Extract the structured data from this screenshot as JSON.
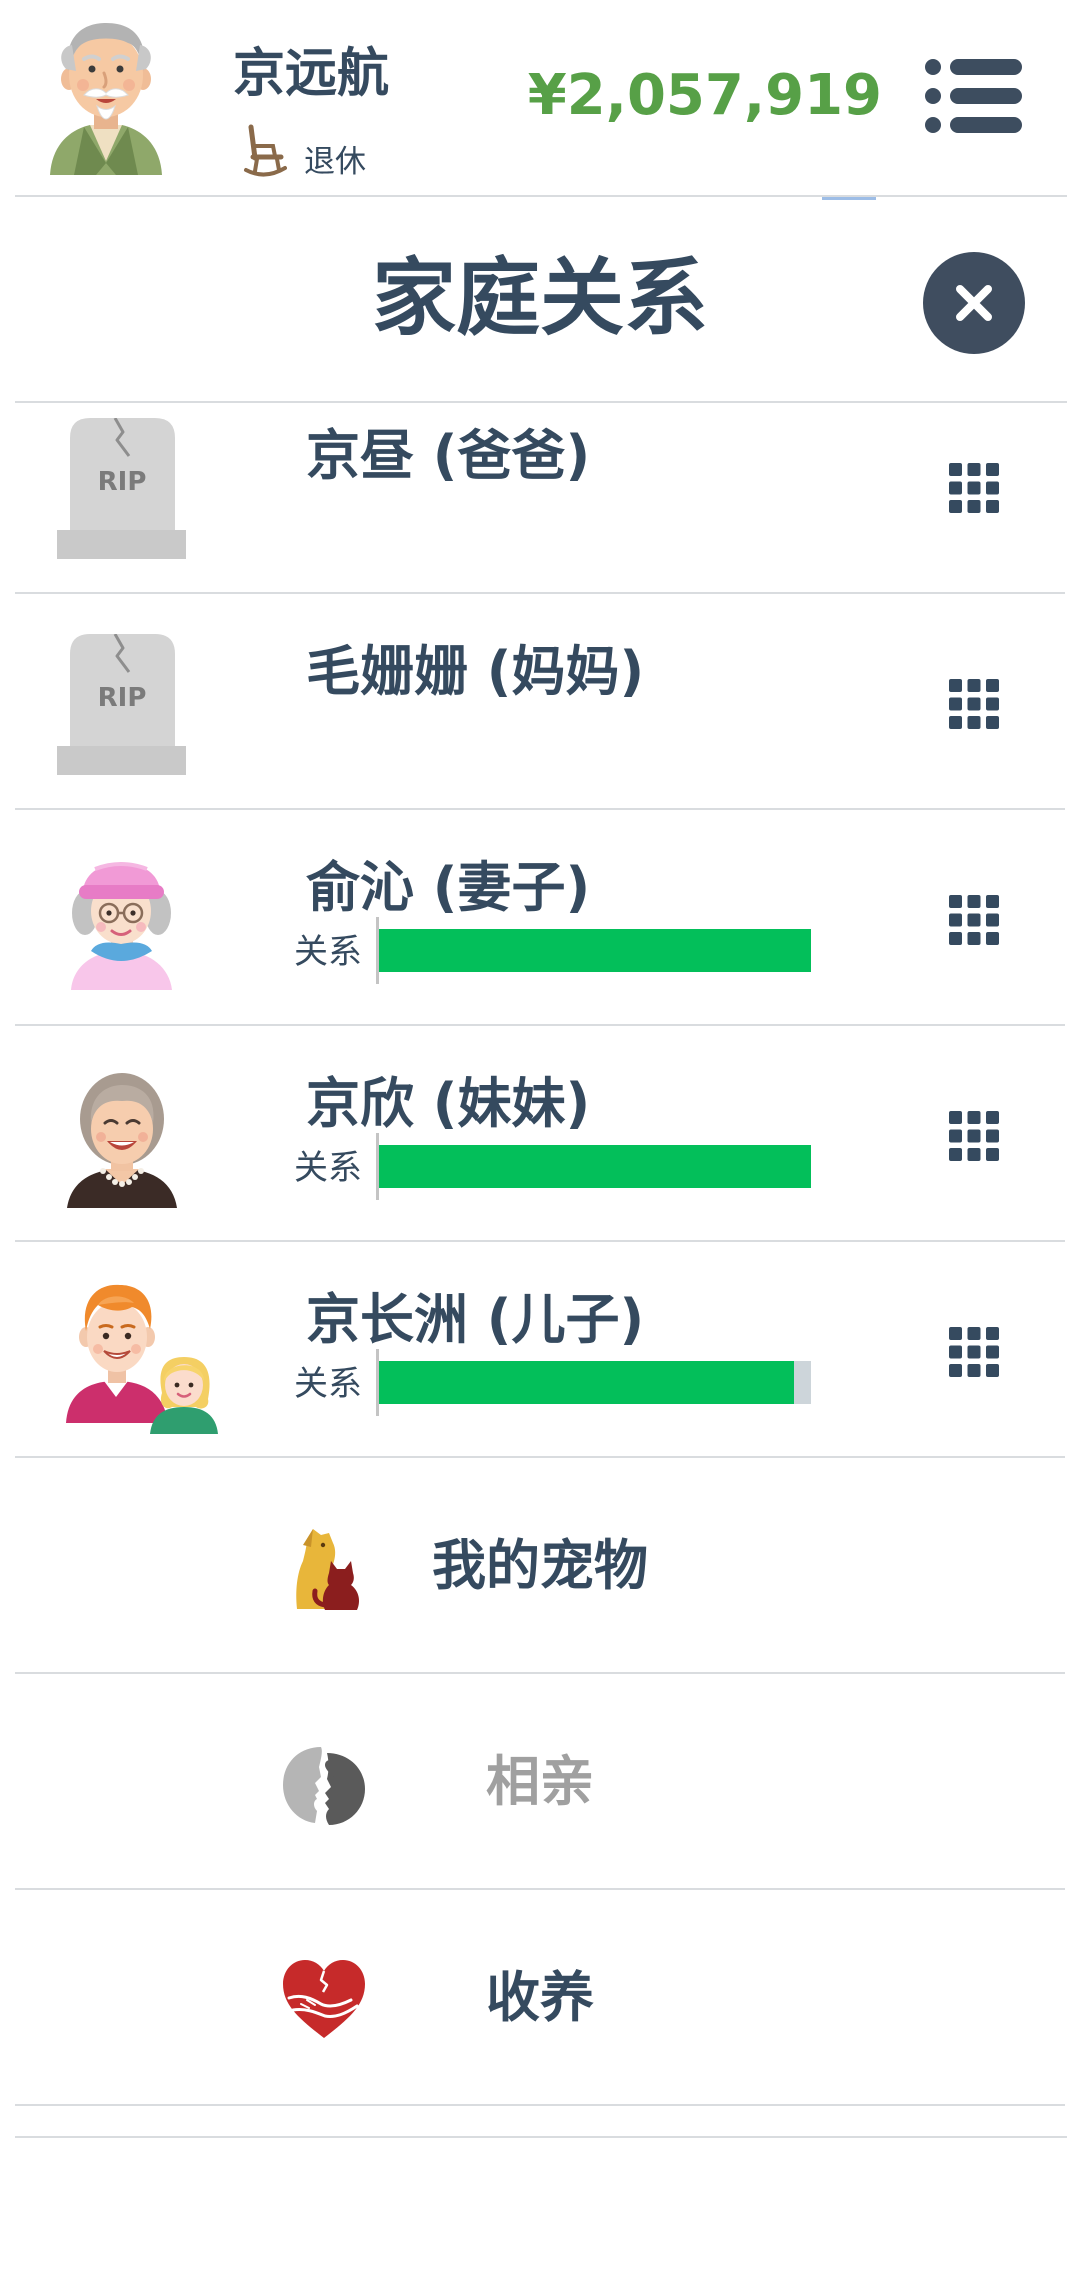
{
  "header": {
    "avatar_icon": "grandpa-avatar",
    "name": "京远航",
    "status_icon": "rocking-chair-icon",
    "status": "退休",
    "money": "¥2,057,919",
    "menu_icon": "menu-list-icon"
  },
  "panel": {
    "title": "家庭关系",
    "close_icon": "close-icon"
  },
  "relationship_label": "关系",
  "family": [
    {
      "name": "京昼 (爸爸)",
      "icon": "tombstone-icon",
      "tombstone_text": "RIP",
      "options_icon": "grid-menu-icon"
    },
    {
      "name": "毛姗姗 (妈妈)",
      "icon": "tombstone-icon",
      "tombstone_text": "RIP",
      "options_icon": "grid-menu-icon"
    },
    {
      "name": "俞沁 (妻子)",
      "icon": "elderly-woman-pink-hat-avatar",
      "relationship": 1.0,
      "options_icon": "grid-menu-icon"
    },
    {
      "name": "京欣 (妹妹)",
      "icon": "elderly-woman-avatar",
      "relationship": 1.0,
      "options_icon": "grid-menu-icon"
    },
    {
      "name": "京长洲 (儿子)",
      "icon": "man-and-child-avatar",
      "relationship": 0.96,
      "options_icon": "grid-menu-icon"
    }
  ],
  "actions": [
    {
      "label": "我的宠物",
      "icon": "pet-icon",
      "enabled": true
    },
    {
      "label": "相亲",
      "icon": "dating-icon",
      "enabled": false
    },
    {
      "label": "收养",
      "icon": "adoption-heart-icon",
      "enabled": true
    }
  ],
  "colors": {
    "text": "#354a5f",
    "money": "#57a047",
    "bar_fill": "#03bf5a",
    "bar_track": "#cdd5da",
    "muted": "#a0a0a0",
    "divider": "#d9dcdf",
    "close_button": "#3f4d5f"
  }
}
